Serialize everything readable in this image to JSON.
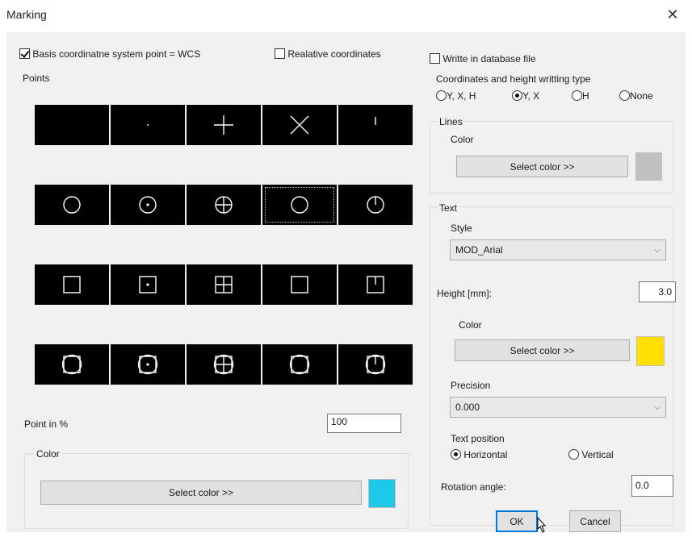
{
  "window": {
    "title": "Marking",
    "close_glyph": "✕"
  },
  "left": {
    "basis_wcs": {
      "label": "Basis coordinatne system point = WCS",
      "checked": true
    },
    "relative": {
      "label": "Realative coordinates",
      "checked": false
    },
    "points_label": "Points",
    "point_symbols": [
      "blank",
      "dot",
      "plus",
      "cross",
      "tick",
      "circle",
      "circle-dot",
      "circle-plus",
      "circle-x",
      "circle-tick",
      "square",
      "square-dot",
      "square-plus",
      "square-x",
      "square-tick",
      "circle-square",
      "circle-square-dot",
      "circle-square-plus",
      "circle-square-x",
      "circle-square-tick"
    ],
    "selected_symbol_index": 8,
    "point_percent_label": "Point in %",
    "point_percent_value": "100",
    "color_group_label": "Color",
    "select_color_label": "Select color >>",
    "color_swatch": "#1ec8e8"
  },
  "right": {
    "write_db": {
      "label": "Writte in database file",
      "checked": false
    },
    "coord_type_label": "Coordinates and height writting type",
    "coord_options": [
      {
        "label": "Y, X, H",
        "selected": false
      },
      {
        "label": "Y, X",
        "selected": true
      },
      {
        "label": "H",
        "selected": false
      },
      {
        "label": "None",
        "selected": false
      }
    ],
    "lines": {
      "label": "Lines",
      "color_label": "Color",
      "select_color_label": "Select color >>",
      "swatch": "#c0c0c0"
    },
    "text": {
      "label": "Text",
      "style_label": "Style",
      "style_value": "MOD_Arial",
      "height_label": "Height [mm]:",
      "height_value": "3.0",
      "color_label": "Color",
      "select_color_label": "Select color >>",
      "swatch": "#ffe000",
      "precision_label": "Precision",
      "precision_value": "0.000",
      "position_label": "Text position",
      "position_options": [
        {
          "label": "Horizontal",
          "selected": true
        },
        {
          "label": "Vertical",
          "selected": false
        }
      ],
      "rotation_label": "Rotation angle:",
      "rotation_value": "0.0"
    },
    "ok_label": "OK",
    "cancel_label": "Cancel"
  }
}
